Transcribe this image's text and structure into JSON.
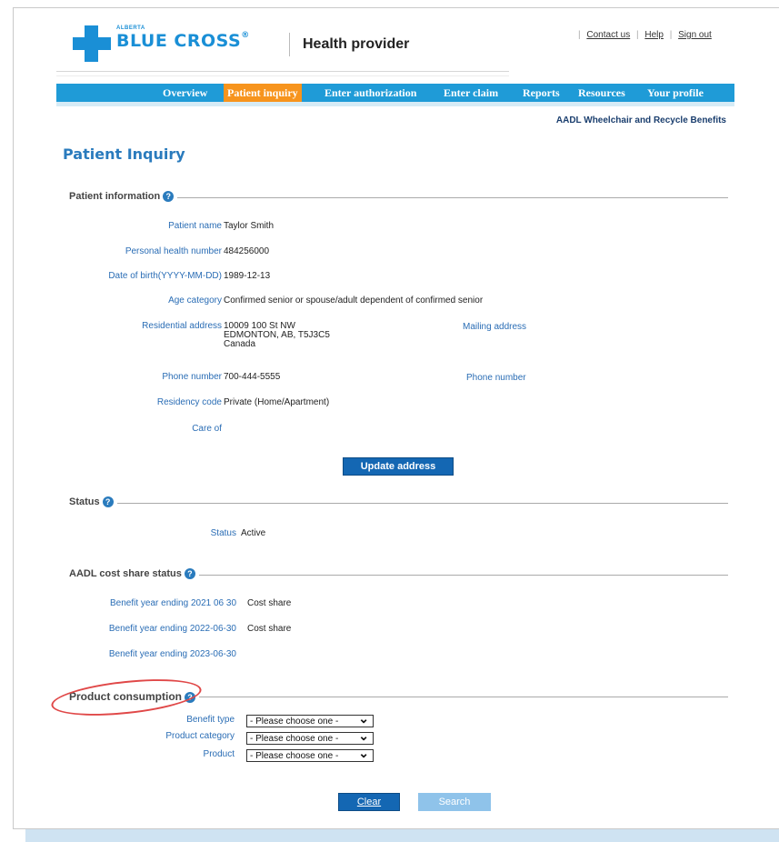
{
  "header": {
    "logo_small": "ALBERTA",
    "logo_big": "BLUE CROSS",
    "logo_reg": "®",
    "subtitle": "Health provider",
    "links": {
      "contact": "Contact us",
      "help": "Help",
      "signout": "Sign out",
      "sep": "|"
    }
  },
  "nav": {
    "items": [
      "Overview",
      "Patient inquiry",
      "Enter authorization",
      "Enter claim",
      "Reports",
      "Resources",
      "Your profile"
    ],
    "active": "Patient inquiry"
  },
  "program": "AADL Wheelchair and Recycle Benefits",
  "page_title": "Patient Inquiry",
  "patient_info": {
    "section_title": "Patient information",
    "patient_name_label": "Patient name",
    "patient_name": "Taylor Smith",
    "phn_label": "Personal health number",
    "phn": "484256000",
    "dob_label": "Date of birth(YYYY-MM-DD)",
    "dob": "1989-12-13",
    "age_label": "Age category",
    "age": "Confirmed senior or spouse/adult dependent of confirmed senior",
    "res_address_label": "Residential address",
    "res_address_line1": "10009 100 St NW",
    "res_address_line2": "EDMONTON, AB, T5J3C5",
    "res_address_line3": "Canada",
    "mailing_address_label": "Mailing address",
    "phone_label": "Phone number",
    "phone": "700-444-5555",
    "phone2_label": "Phone number",
    "residency_label": "Residency code",
    "residency": "Private (Home/Apartment)",
    "care_of_label": "Care of",
    "update_button": "Update address"
  },
  "status": {
    "section_title": "Status",
    "label": "Status",
    "value": "Active"
  },
  "cost_share": {
    "section_title": "AADL cost share status",
    "rows": [
      {
        "label": "Benefit year ending 2021 06 30",
        "value": "Cost share"
      },
      {
        "label": "Benefit year ending 2022-06-30",
        "value": "Cost share"
      },
      {
        "label": "Benefit year ending 2023-06-30",
        "value": ""
      }
    ]
  },
  "product": {
    "section_title": "Product consumption",
    "benefit_type_label": "Benefit type",
    "product_category_label": "Product category",
    "product_label": "Product",
    "placeholder": "- Please choose one -"
  },
  "buttons": {
    "clear": "Clear",
    "search": "Search"
  },
  "help_glyph": "?",
  "colors": {
    "accent": "#1f9bd7",
    "active_tab": "#f7941d",
    "brand": "#1a8fd6",
    "highlight": "#e04848"
  }
}
